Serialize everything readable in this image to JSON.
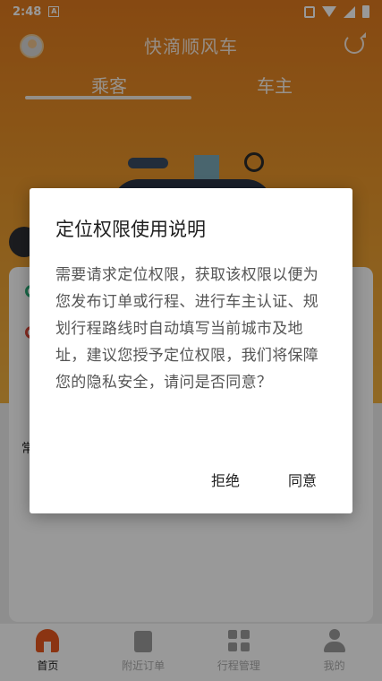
{
  "status_bar": {
    "time": "2:48",
    "notification_icon_letter": "A"
  },
  "app": {
    "title": "快滴顺风车",
    "role_tabs": [
      {
        "label": "乘客",
        "active": true
      },
      {
        "label": "车主",
        "active": false
      }
    ],
    "card": {
      "common_label": "常"
    }
  },
  "tabbar": {
    "items": [
      {
        "label": "首页",
        "icon": "home-icon",
        "active": true
      },
      {
        "label": "附近订单",
        "icon": "order-icon",
        "active": false
      },
      {
        "label": "行程管理",
        "icon": "trip-icon",
        "active": false
      },
      {
        "label": "我的",
        "icon": "profile-icon",
        "active": false
      }
    ]
  },
  "dialog": {
    "title": "定位权限使用说明",
    "body": "需要请求定位权限，获取该权限以便为您发布订单或行程、进行车主认证、规划行程路线时自动填写当前城市及地址，建议您授予定位权限，我们将保障您的隐私安全，请问是否同意？",
    "reject_label": "拒绝",
    "agree_label": "同意"
  },
  "colors": {
    "brand_orange": "#e07a1e",
    "home_active": "#e8581e"
  }
}
